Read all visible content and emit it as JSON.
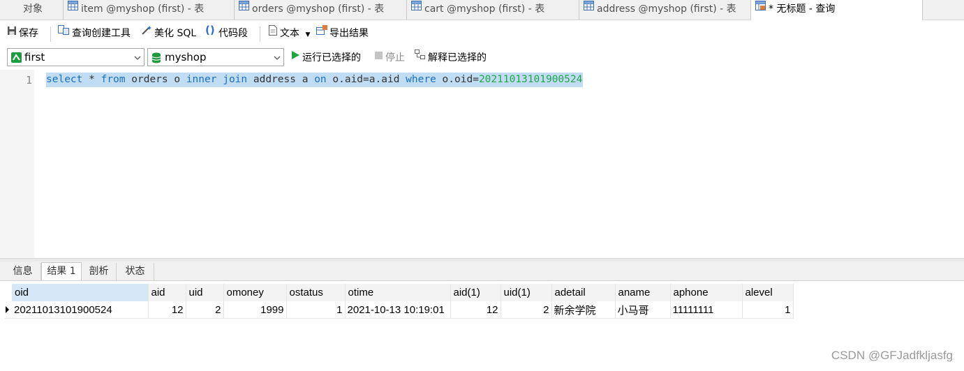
{
  "tabs": [
    {
      "label": "对象",
      "icon": "none"
    },
    {
      "label": "item @myshop (first) - 表",
      "icon": "table-icon"
    },
    {
      "label": "orders @myshop (first) - 表",
      "icon": "table-icon"
    },
    {
      "label": "cart @myshop (first) - 表",
      "icon": "table-icon"
    },
    {
      "label": "address @myshop (first) - 表",
      "icon": "table-icon"
    },
    {
      "label": "* 无标题 - 查询",
      "icon": "query-icon",
      "active": true
    }
  ],
  "toolbar": {
    "save": "保存",
    "query_builder": "查询创建工具",
    "beautify": "美化 SQL",
    "snippet": "代码段",
    "text": "文本",
    "export": "导出结果"
  },
  "connection": {
    "server": "first",
    "database": "myshop",
    "run_selected": "运行已选择的",
    "stop": "停止",
    "explain_selected": "解释已选择的"
  },
  "editor": {
    "line_number": "1",
    "sql": {
      "t1": "select",
      "t2": "*",
      "t3": "from",
      "t4": "orders o",
      "t5": "inner",
      "t6": "join",
      "t7": "address a",
      "t8": "on",
      "t9": "o.aid=a.aid",
      "t10": "where",
      "t11": "o.oid=",
      "t12": "20211013101900524"
    }
  },
  "result_tabs": [
    "信息",
    "结果 1",
    "剖析",
    "状态"
  ],
  "result": {
    "columns": [
      "oid",
      "aid",
      "uid",
      "omoney",
      "ostatus",
      "otime",
      "aid(1)",
      "uid(1)",
      "adetail",
      "aname",
      "aphone",
      "alevel"
    ],
    "rows": [
      [
        "20211013101900524",
        "12",
        "2",
        "1999",
        "1",
        "2021-10-13 10:19:01",
        "12",
        "2",
        "新余学院",
        "小马哥",
        "11111111",
        "1"
      ]
    ]
  },
  "watermark": "CSDN @GFJadfkljasfg",
  "colors": {
    "keyword": "#1e6ec4",
    "number": "#23a44a",
    "selection": "#c1ddf3"
  }
}
